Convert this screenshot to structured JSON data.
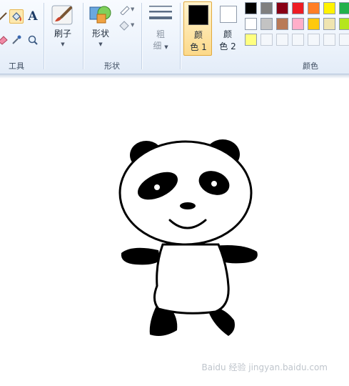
{
  "app": "Paint",
  "groups": {
    "tools_label": "工具",
    "shapes_label": "形状",
    "colors_label": "颜色"
  },
  "brush": {
    "label": "刷子"
  },
  "shapes": {
    "label": "形状"
  },
  "size": {
    "label_line1": "粗",
    "label_line2": "细"
  },
  "color1": {
    "label_line1": "颜",
    "label_line2": "色 1",
    "value": "#000000"
  },
  "color2": {
    "label_line1": "颜",
    "label_line2": "色 2",
    "value": "#ffffff"
  },
  "palette": {
    "row1": [
      "#000000",
      "#7f7f7f",
      "#880015",
      "#ed1c24",
      "#ff7f27",
      "#fff200",
      "#22b14c"
    ],
    "row2": [
      "#ffffff",
      "#c3c3c3",
      "#b97a57",
      "#ffaec9",
      "#ffc90e",
      "#efe4b0",
      "#b5e61d"
    ],
    "row3": [
      "#ffff80",
      "",
      "",
      "",
      "",
      "",
      ""
    ]
  },
  "watermark": {
    "text": "Baidu 经验  jingyan.baidu.com"
  }
}
